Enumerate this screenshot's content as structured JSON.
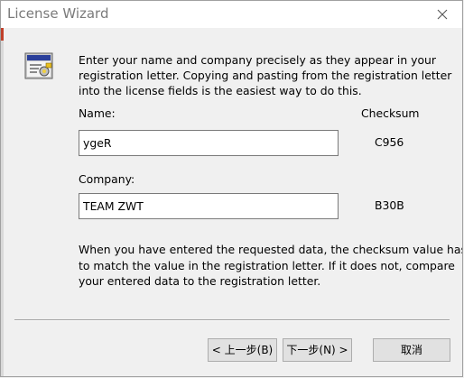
{
  "window": {
    "title": "License Wizard"
  },
  "intro_text": [
    "Enter your name and company precisely as they appear in your",
    "registration letter.  Copying and pasting from the registration letter",
    "into the license fields is the easiest way to do this."
  ],
  "fields": {
    "name_label": "Name:",
    "checksum_header": "Checksum",
    "name_value": "ygeR",
    "name_checksum": "C956",
    "company_label": "Company:",
    "company_value": "TEAM ZWT",
    "company_checksum": "B30B"
  },
  "footer_text": [
    "When you have entered the requested data, the checksum value has",
    "to match the value in the registration letter.  If it does not, compare",
    "your entered data to the registration letter."
  ],
  "buttons": {
    "back": "< 上一步(B)",
    "next": "下一步(N) >",
    "cancel": "取消"
  },
  "colors": {
    "dialog_bg": "#f0f0f0",
    "title_text": "#7a7a7a",
    "button_bg": "#e1e1e1"
  }
}
